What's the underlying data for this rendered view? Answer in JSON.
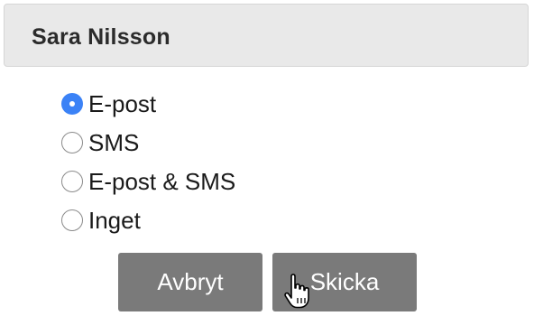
{
  "header": {
    "title": "Sara Nilsson"
  },
  "notification_options": [
    {
      "label": "E-post",
      "selected": true
    },
    {
      "label": "SMS",
      "selected": false
    },
    {
      "label": "E-post & SMS",
      "selected": false
    },
    {
      "label": "Inget",
      "selected": false
    }
  ],
  "actions": {
    "cancel_label": "Avbryt",
    "send_label": "Skicka"
  },
  "colors": {
    "header_bg": "#e9e9e9",
    "radio_selected": "#3b82f6",
    "button_bg": "#7a7a7a",
    "button_text": "#ffffff"
  },
  "cursor": {
    "icon": "hand-pointer-icon"
  }
}
